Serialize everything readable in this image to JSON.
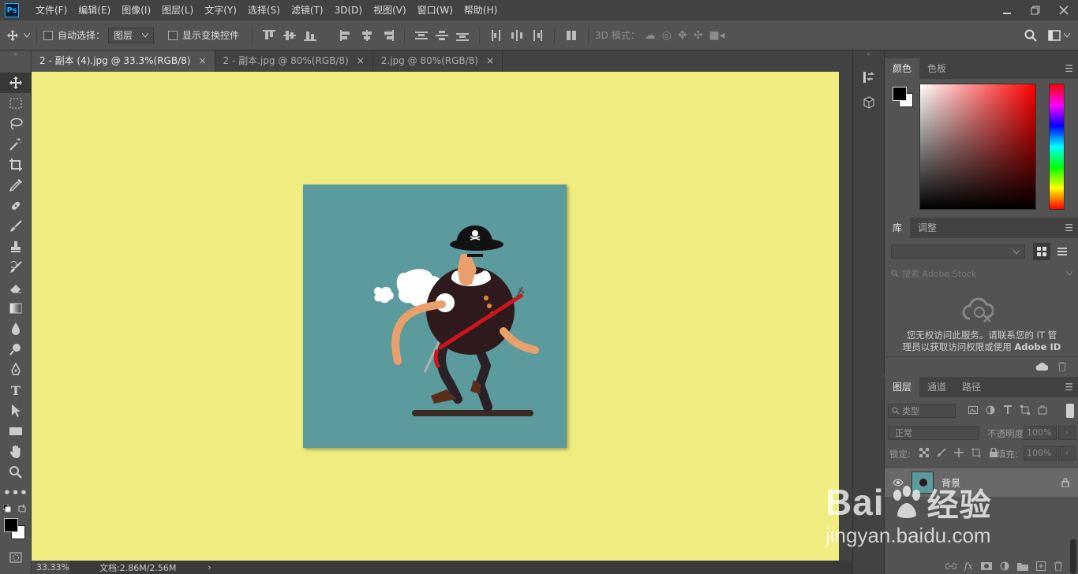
{
  "app": {
    "logo": "Ps"
  },
  "menu": [
    "文件(F)",
    "编辑(E)",
    "图像(I)",
    "图层(L)",
    "文字(Y)",
    "选择(S)",
    "滤镜(T)",
    "3D(D)",
    "视图(V)",
    "窗口(W)",
    "帮助(H)"
  ],
  "options": {
    "auto_select_label": "自动选择：",
    "auto_select_value": "图层",
    "show_transform_label": "显示变换控件",
    "mode3d_label": "3D 模式："
  },
  "tabs": [
    {
      "label": "2 - 副本 (4).jpg @ 33.3%(RGB/8)",
      "close": "×"
    },
    {
      "label": "2 - 副本.jpg @ 80%(RGB/8)",
      "close": "×"
    },
    {
      "label": "2.jpg @ 80%(RGB/8)",
      "close": "×"
    }
  ],
  "status": {
    "zoom": "33.33%",
    "doc": "文档:2.86M/2.56M",
    "arrow": "›"
  },
  "colors": {
    "canvas_bg": "#efed80",
    "doc_bg": "#5b9a9d",
    "foreground": "#000000",
    "background": "#ffffff"
  },
  "color_panel": {
    "tabs": [
      "颜色",
      "色板"
    ]
  },
  "library_panel": {
    "tabs": [
      "库",
      "调整"
    ],
    "search_placeholder": "搜索 Adobe Stock",
    "message_line1": "您无权访问此服务。请联系您的 IT 管",
    "message_line2a": "理员以获取访问权限或使用",
    "message_line2b": "Adobe ID"
  },
  "layers_panel": {
    "tabs": [
      "图层",
      "通道",
      "路径"
    ],
    "filter_label": "类型",
    "blend_mode": "正常",
    "opacity_label": "不透明度:",
    "opacity_value": "100%",
    "lock_label": "锁定:",
    "fill_label": "填充:",
    "fill_value": "100%",
    "layers": [
      {
        "name": "背景"
      }
    ]
  },
  "watermark": {
    "brand": "Bai",
    "brand2": "经验",
    "url": "jingyan.baidu.com"
  }
}
